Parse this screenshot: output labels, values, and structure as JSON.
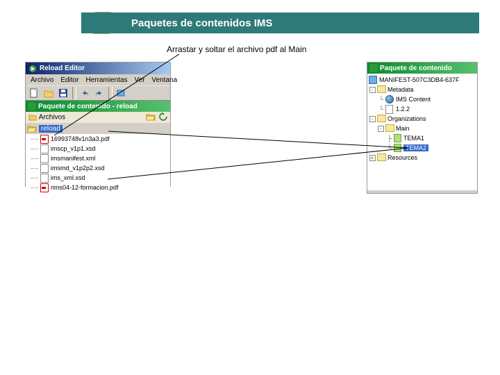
{
  "slide": {
    "title": "Paquetes de contenidos IMS",
    "subtitle": "Arrastar y soltar el archivo pdf al Main"
  },
  "left_window": {
    "app_title": "Reload Editor",
    "menu": [
      "Archivo",
      "Editor",
      "Herramientas",
      "Ver",
      "Ventana"
    ],
    "panel_title": "Paquete de contenido - reload",
    "panel_subtitle": "Archivos",
    "folder": "reload",
    "files": [
      {
        "name": "16993748v1n3a3.pdf",
        "type": "pdf"
      },
      {
        "name": "imscp_v1p1.xsd",
        "type": "xsd"
      },
      {
        "name": "imsmanifest.xml",
        "type": "xml"
      },
      {
        "name": "imsmd_v1p2p2.xsd",
        "type": "xsd"
      },
      {
        "name": "ims_xml.xsd",
        "type": "xsd"
      },
      {
        "name": "rims04-12-formacion.pdf",
        "type": "pdf"
      }
    ]
  },
  "right_window": {
    "panel_title": "Paquete de contenido",
    "root": "MANIFEST-507C3DB4-637F",
    "nodes": {
      "metadata": "Metadata",
      "ims_content": "IMS Content",
      "version": "1.2.2",
      "organizations": "Organizations",
      "main": "Main",
      "tema1": "TEMA1",
      "tema2": "TEMA2",
      "resources": "Resources"
    }
  }
}
